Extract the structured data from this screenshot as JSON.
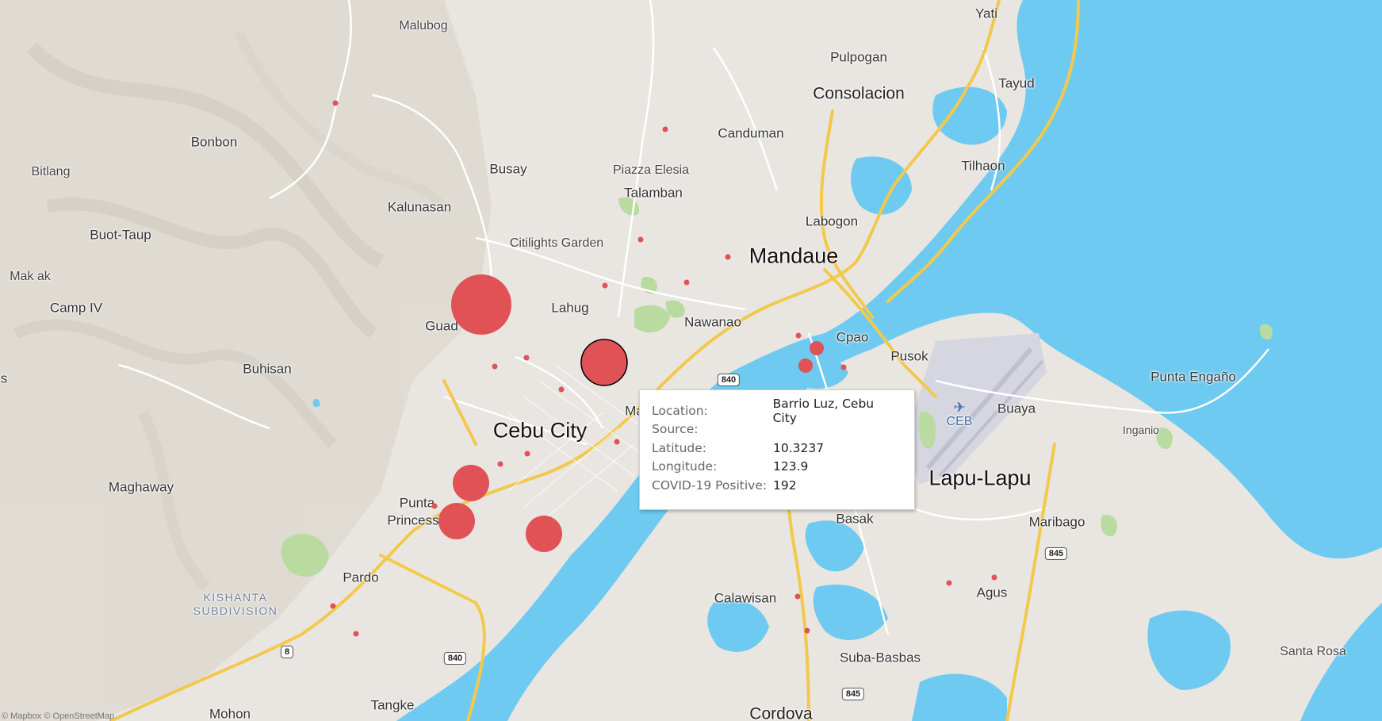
{
  "map": {
    "places": [
      {
        "name": "Malubog",
        "size": "sm"
      },
      {
        "name": "Yati",
        "size": "md"
      },
      {
        "name": "Pulpogan",
        "size": "md"
      },
      {
        "name": "Consolacion",
        "size": "lg"
      },
      {
        "name": "Tayud",
        "size": "md"
      },
      {
        "name": "Bonbon",
        "size": "md"
      },
      {
        "name": "Canduman",
        "size": "md"
      },
      {
        "name": "Busay",
        "size": "md"
      },
      {
        "name": "Tilhaon",
        "size": "md"
      },
      {
        "name": "Bitlang",
        "size": "sm"
      },
      {
        "name": "Piazza Elesia",
        "size": "sm"
      },
      {
        "name": "Talamban",
        "size": "md"
      },
      {
        "name": "Kalunasan",
        "size": "md"
      },
      {
        "name": "Labogon",
        "size": "md"
      },
      {
        "name": "Buot-Taup",
        "size": "md"
      },
      {
        "name": "Citilights Garden",
        "size": "sm"
      },
      {
        "name": "Mandaue",
        "size": "xl"
      },
      {
        "name": "Mak ak",
        "size": "sm"
      },
      {
        "name": "Lahug",
        "size": "md"
      },
      {
        "name": "Camp IV",
        "size": "md"
      },
      {
        "name": "Nawanao",
        "size": "md"
      },
      {
        "name": "Guad",
        "size": "md"
      },
      {
        "name": "Cpao",
        "size": "md"
      },
      {
        "name": "Pusok",
        "size": "md"
      },
      {
        "name": "Buhisan",
        "size": "md"
      },
      {
        "name": "Punta Engaño",
        "size": "md"
      },
      {
        "name": "s",
        "size": "md"
      },
      {
        "name": "Ma",
        "size": "md"
      },
      {
        "name": "Buaya",
        "size": "md"
      },
      {
        "name": "Cebu City",
        "size": "xl"
      },
      {
        "name": "Inganio",
        "size": "xs"
      },
      {
        "name": "Lapu-Lapu",
        "size": "xl"
      },
      {
        "name": "Maghaway",
        "size": "md"
      },
      {
        "name": "Punta",
        "size": "md"
      },
      {
        "name": "Princess",
        "size": "md"
      },
      {
        "name": "Basak",
        "size": "md"
      },
      {
        "name": "Maribago",
        "size": "md"
      },
      {
        "name": "Pardo",
        "size": "md"
      },
      {
        "name": "KISHANTA\nSUBDIVISION",
        "size": "area"
      },
      {
        "name": "Calawisan",
        "size": "md"
      },
      {
        "name": "Agus",
        "size": "md"
      },
      {
        "name": "Santa Rosa",
        "size": "sm"
      },
      {
        "name": "Suba-Basbas",
        "size": "md"
      },
      {
        "name": "Mohon",
        "size": "md"
      },
      {
        "name": "Tangke",
        "size": "md"
      },
      {
        "name": "Cordova",
        "size": "lg"
      }
    ],
    "airport_code": "CEB",
    "road_shields": [
      "840",
      "840",
      "845",
      "845",
      "8"
    ],
    "attribution": "© Mapbox © OpenStreetMap",
    "colors": {
      "land": "#e9e6e1",
      "water": "#6ecaf0",
      "park": "#b9dba0",
      "road_major": "#f2c94c",
      "marker": "#e05256",
      "marker_selected_stroke": "#000000"
    }
  },
  "markers": [
    {
      "size": "xl"
    },
    {
      "size": "lg",
      "selected": true
    },
    {
      "size": "md"
    },
    {
      "size": "md"
    },
    {
      "size": "md"
    },
    {
      "size": "sm"
    },
    {
      "size": "sm"
    },
    {
      "size": "dot"
    },
    {
      "size": "dot"
    },
    {
      "size": "dot"
    },
    {
      "size": "dot"
    },
    {
      "size": "dot"
    },
    {
      "size": "dot"
    },
    {
      "size": "dot"
    },
    {
      "size": "dot"
    },
    {
      "size": "dot"
    },
    {
      "size": "dot"
    },
    {
      "size": "dot"
    },
    {
      "size": "dot"
    },
    {
      "size": "dot"
    },
    {
      "size": "dot"
    },
    {
      "size": "dot"
    },
    {
      "size": "dot"
    },
    {
      "size": "dot"
    },
    {
      "size": "dot"
    },
    {
      "size": "dot"
    },
    {
      "size": "dot"
    },
    {
      "size": "dot"
    }
  ],
  "tooltip": {
    "rows": [
      {
        "key": "Location:",
        "value": "Barrio Luz, Cebu City"
      },
      {
        "key": "Source:",
        "value": ""
      },
      {
        "key": "Latitude:",
        "value": "10.3237"
      },
      {
        "key": "Longitude:",
        "value": "123.9"
      },
      {
        "key": "COVID-19 Positive:",
        "value": "192"
      }
    ]
  }
}
